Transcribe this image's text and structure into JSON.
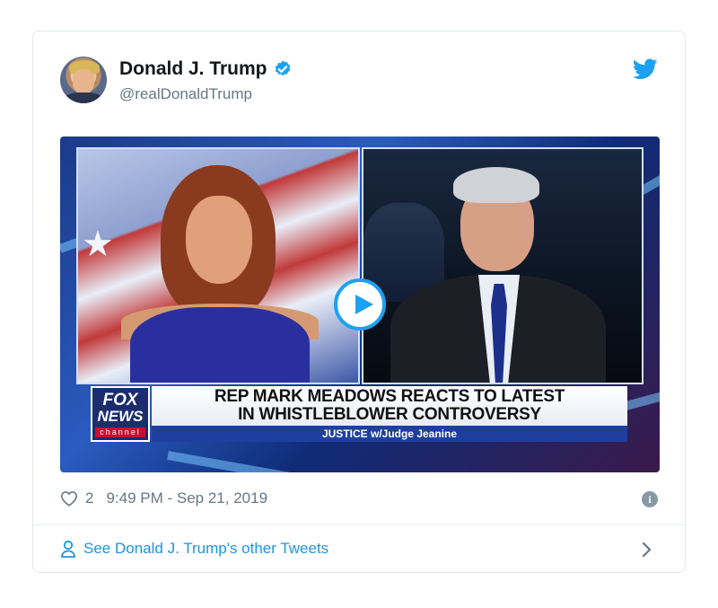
{
  "tweet": {
    "author_name": "Donald J. Trump",
    "handle": "@realDonaldTrump",
    "likes": "2",
    "timestamp": "9:49 PM - Sep 21, 2019",
    "footer_link": "See Donald J. Trump's other Tweets"
  },
  "video": {
    "logo_line1": "FOX",
    "logo_line2": "NEWS",
    "logo_line3": "channel",
    "headline_line1": "REP MARK MEADOWS REACTS TO LATEST",
    "headline_line2": "IN WHISTLEBLOWER CONTROVERSY",
    "subbar": "JUSTICE w/Judge Jeanine"
  },
  "colors": {
    "accent": "#1da1f2",
    "link": "#1b95e0",
    "muted": "#657786"
  },
  "icons": [
    "verified-badge-icon",
    "twitter-bird-icon",
    "play-icon",
    "heart-icon",
    "info-icon",
    "person-icon",
    "chevron-right-icon"
  ]
}
